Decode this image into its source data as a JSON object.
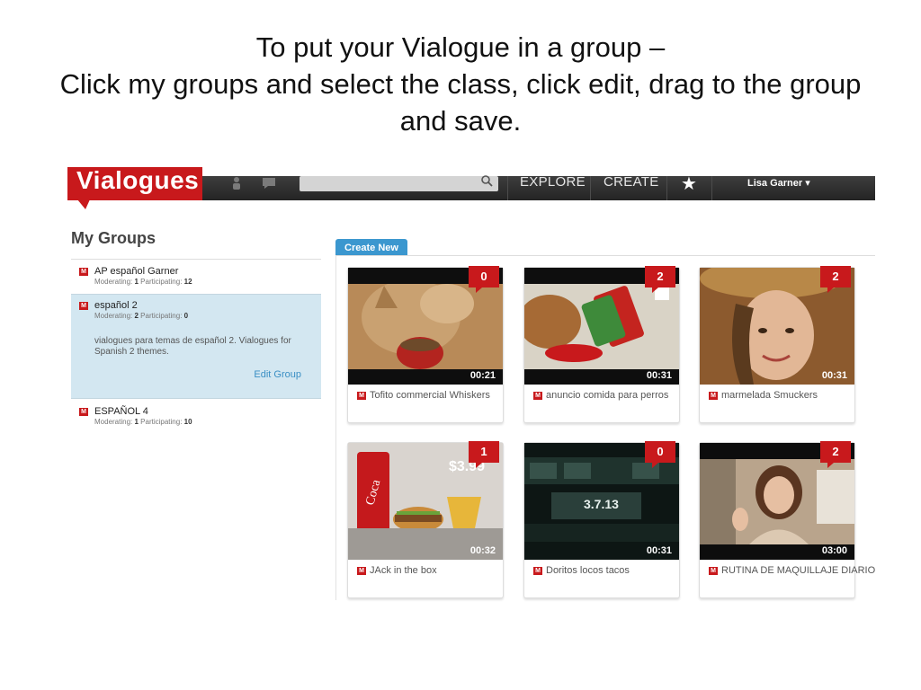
{
  "slide": {
    "title_line1": "To put your Vialogue in a group –",
    "title_line2": "Click my groups and select the class, click edit, drag to the group and save."
  },
  "navbar": {
    "logo_text": "Vialogues",
    "search": {
      "placeholder": ""
    },
    "links": [
      "EXPLORE",
      "CREATE"
    ],
    "user": "Lisa Garner ▾",
    "colors": {
      "brand": "#c8191c",
      "bar": "#2e2e2e"
    }
  },
  "sidebar": {
    "heading": "My Groups",
    "groups": [
      {
        "badge": "M",
        "name": "AP español Garner",
        "moderating_label": "Moderating:",
        "moderating": "1",
        "participating_label": "Participating:",
        "participating": "12"
      },
      {
        "badge": "M",
        "name": "español 2",
        "moderating_label": "Moderating:",
        "moderating": "2",
        "participating_label": "Participating:",
        "participating": "0",
        "description": "vialogues para temas de español 2. Vialogues for Spanish 2 themes.",
        "edit_label": "Edit Group"
      },
      {
        "badge": "M",
        "name": "ESPAÑOL 4",
        "moderating_label": "Moderating:",
        "moderating": "1",
        "participating_label": "Participating:",
        "participating": "10"
      }
    ]
  },
  "main": {
    "create_new_label": "Create New",
    "cards": [
      {
        "count": "0",
        "duration": "00:21",
        "badge": "M",
        "title": "Tofito commercial Whiskers",
        "scene": "cat"
      },
      {
        "count": "2",
        "duration": "00:31",
        "badge": "M",
        "title": "anuncio comida para perros",
        "scene": "dog"
      },
      {
        "count": "2",
        "duration": "00:31",
        "badge": "M",
        "title": "marmelada Smuckers",
        "scene": "girl"
      },
      {
        "count": "1",
        "duration": "00:32",
        "badge": "M",
        "title": "JAck in the box",
        "scene": "food"
      },
      {
        "count": "0",
        "duration": "00:31",
        "badge": "M",
        "title": "Doritos locos tacos",
        "scene": "bus"
      },
      {
        "count": "2",
        "duration": "03:00",
        "badge": "M",
        "title": "RUTINA DE MAQUILLAJE DIARIO",
        "scene": "woman"
      }
    ],
    "thumb_overlays": {
      "bus_sign": "3.7.13",
      "price": "$3.99"
    }
  }
}
